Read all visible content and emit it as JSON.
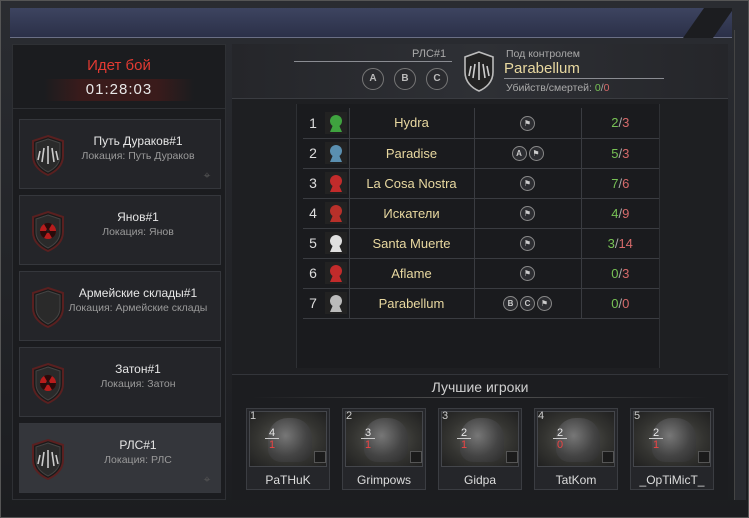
{
  "battle": {
    "status": "Идет бой",
    "timer": "01:28:03"
  },
  "locations": [
    {
      "name": "Путь Дураков#1",
      "sub": "Локация: Путь Дураков",
      "emblem": "winged-shield-icon"
    },
    {
      "name": "Янов#1",
      "sub": "Локация: Янов",
      "emblem": "radiation-shield-icon"
    },
    {
      "name": "Армейские склады#1",
      "sub": "Локация: Армейские склады",
      "emblem": "empty-shield-icon"
    },
    {
      "name": "Затон#1",
      "sub": "Локация: Затон",
      "emblem": "radiation-shield-icon"
    },
    {
      "name": "РЛС#1",
      "sub": "Локация: РЛС",
      "emblem": "winged-shield-icon"
    }
  ],
  "header": {
    "point": "РЛС#1",
    "abc": [
      "A",
      "B",
      "C"
    ],
    "controlled_label": "Под контролем",
    "controlled_by": "Parabellum",
    "kd_label": "Убийств/смертей:",
    "kills": "0",
    "deaths": "0"
  },
  "clans": [
    {
      "rank": "1",
      "name": "Hydra",
      "flags": [],
      "kills": "2",
      "deaths": "3",
      "emblem_color": "#3fa33f"
    },
    {
      "rank": "2",
      "name": "Paradise",
      "flags": [
        "A"
      ],
      "kills": "5",
      "deaths": "3",
      "emblem_color": "#5a8fb0"
    },
    {
      "rank": "3",
      "name": "La Cosa Nostra",
      "flags": [],
      "kills": "7",
      "deaths": "6",
      "emblem_color": "#c22b2b"
    },
    {
      "rank": "4",
      "name": "Искатели",
      "flags": [],
      "kills": "4",
      "deaths": "9",
      "emblem_color": "#b8302a"
    },
    {
      "rank": "5",
      "name": "Santa Muerte",
      "flags": [],
      "kills": "3",
      "deaths": "14",
      "emblem_color": "#e0e0e0"
    },
    {
      "rank": "6",
      "name": "Aflame",
      "flags": [],
      "kills": "0",
      "deaths": "3",
      "emblem_color": "#c22b2b"
    },
    {
      "rank": "7",
      "name": "Parabellum",
      "flags": [
        "B",
        "C"
      ],
      "kills": "0",
      "deaths": "0",
      "emblem_color": "#bbbbbb"
    }
  ],
  "best_players": {
    "title": "Лучшие игроки",
    "players": [
      {
        "rank": "1",
        "name": "PaTHuK",
        "kills": "4",
        "deaths": "1"
      },
      {
        "rank": "2",
        "name": "Grimpows",
        "kills": "3",
        "deaths": "1"
      },
      {
        "rank": "3",
        "name": "Gidpa",
        "kills": "2",
        "deaths": "1"
      },
      {
        "rank": "4",
        "name": "TatKom",
        "kills": "2",
        "deaths": "0"
      },
      {
        "rank": "5",
        "name": "_OpTiMicT_",
        "kills": "2",
        "deaths": "1"
      }
    ]
  },
  "colors": {
    "accent_red": "#e23a32",
    "clan_text": "#e8d8a0",
    "kills_green": "#77c255",
    "deaths_red": "#d66a6a"
  }
}
